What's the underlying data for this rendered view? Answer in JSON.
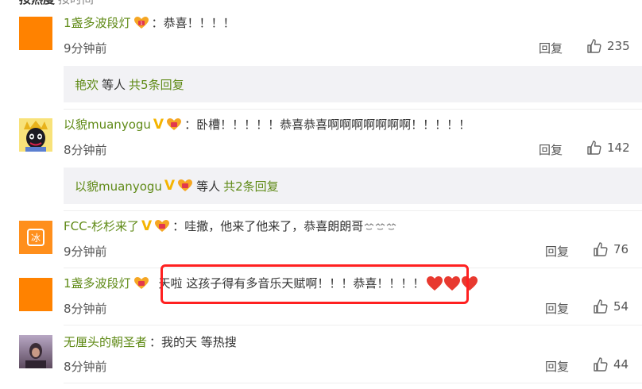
{
  "top_cut_text": {
    "bold": "按热度",
    "rest": "按时间"
  },
  "comments": [
    {
      "username": "1盏多波段灯",
      "text": "恭喜！！！！",
      "time": "9分钟前",
      "reply_label": "回复",
      "likes": "235",
      "replies_box": {
        "user": "艳欢",
        "plain": "等人",
        "more": "共5条回复"
      }
    },
    {
      "username": "以貌muanyogu",
      "text": "卧槽！！！！！恭喜恭喜啊啊啊啊啊啊啊！！！！！",
      "time": "8分钟前",
      "reply_label": "回复",
      "likes": "142",
      "replies_box": {
        "user": "以貌muanyogu",
        "plain": "等人",
        "more": "共2条回复"
      }
    },
    {
      "username": "FCC-杉杉来了",
      "text": "哇撒，他来了他来了，恭喜朗朗哥",
      "time": "9分钟前",
      "reply_label": "回复",
      "likes": "76"
    },
    {
      "username": "1盏多波段灯",
      "text": "天啦 这孩子得有多音乐天赋啊！！！恭喜！！！！",
      "time": "8分钟前",
      "reply_label": "回复",
      "likes": "54"
    },
    {
      "username": "无厘头的朝圣者",
      "text": "我的天 等热搜",
      "time": "8分钟前",
      "reply_label": "回复",
      "likes": "44"
    }
  ],
  "colors": {
    "username": "#5f8a16",
    "accent_orange": "#ff8200",
    "highlight_red": "#ff2020"
  },
  "icons": [
    "fan-badge-icon",
    "verified-v-icon",
    "thumbs-up-icon",
    "heart-icon",
    "shy-face-icon"
  ]
}
